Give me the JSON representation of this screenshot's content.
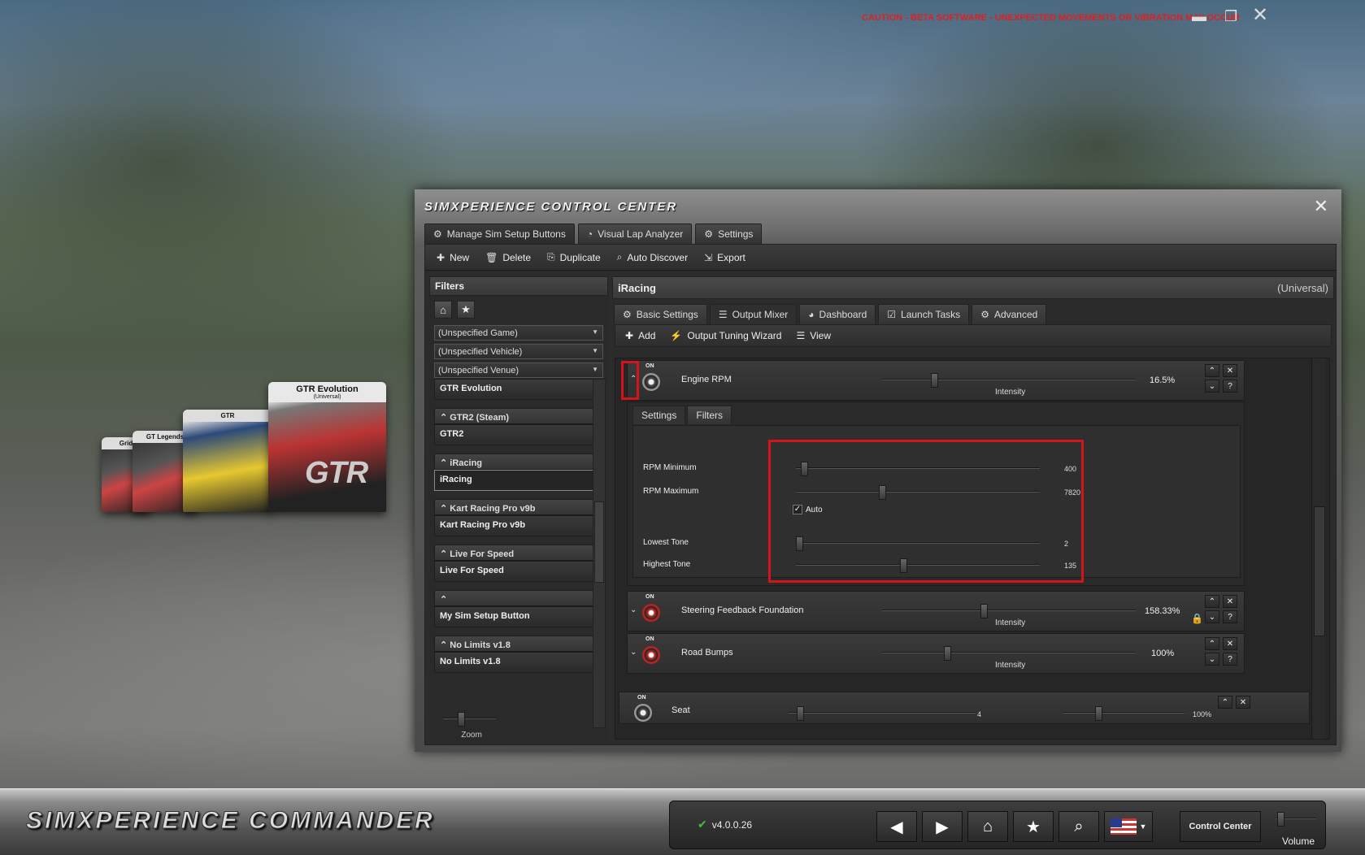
{
  "caution": "CAUTION - BETA SOFTWARE - UNEXPECTED MOVEMENTS OR VIBRATION MAY OCCUR",
  "covers": [
    "Grid",
    "GT Legends",
    "GTR",
    "GTR Evolution"
  ],
  "cover_sub": "(Universal)",
  "cover_logo": "GTR",
  "window": {
    "title": "SIMXPERIENCE CONTROL CENTER",
    "tabs": [
      "Manage Sim Setup Buttons",
      "Visual Lap Analyzer",
      "Settings"
    ]
  },
  "toolbar": [
    "New",
    "Delete",
    "Duplicate",
    "Auto Discover",
    "Export"
  ],
  "filters": {
    "title": "Filters",
    "game": "(Unspecified Game)",
    "vehicle": "(Unspecified Vehicle)",
    "venue": "(Unspecified Venue)"
  },
  "games": {
    "top": "GTR Evolution",
    "groups": [
      {
        "head": "GTR2 (Steam)",
        "item": "GTR2"
      },
      {
        "head": "iRacing",
        "item": "iRacing"
      },
      {
        "head": "Kart Racing Pro v9b",
        "item": "Kart Racing Pro v9b"
      },
      {
        "head": "Live For Speed",
        "item": "Live For Speed"
      },
      {
        "head": "",
        "item": "My Sim Setup Button"
      },
      {
        "head": "No Limits v1.8",
        "item": "No Limits v1.8"
      }
    ]
  },
  "zoom_label": "Zoom",
  "content": {
    "title": "iRacing",
    "scope": "(Universal)",
    "tabs": [
      "Basic Settings",
      "Output Mixer",
      "Dashboard",
      "Launch Tasks",
      "Advanced"
    ],
    "subtools": [
      "Add",
      "Output Tuning Wizard",
      "View"
    ]
  },
  "mixer": {
    "on_label": "ON",
    "intensity_label": "Intensity",
    "rows": [
      {
        "name": "Engine RPM",
        "pct": "16.5%",
        "level": 0.2
      },
      {
        "name": "Steering Feedback Foundation",
        "pct": "158.33%",
        "level": 0.4
      },
      {
        "name": "Road Bumps",
        "pct": "100%",
        "level": 0.25
      }
    ],
    "seat": {
      "name": "Seat",
      "val1": "4",
      "val2": "100%"
    },
    "inner_tabs": [
      "Settings",
      "Filters"
    ],
    "params": [
      {
        "label": "RPM Minimum",
        "value": "400",
        "level": 0.02
      },
      {
        "label": "RPM Maximum",
        "value": "7820",
        "level": 0.35
      },
      {
        "label": "Lowest Tone",
        "value": "2",
        "level": 0.0
      },
      {
        "label": "Highest Tone",
        "value": "135",
        "level": 0.44
      }
    ],
    "auto_label": "Auto",
    "auto_checked": true
  },
  "bottom": {
    "brand": "SIMXPERIENCE COMMANDER",
    "version": "v4.0.0.26",
    "control_center": "Control Center",
    "volume": "Volume"
  },
  "colors": {
    "caution": "#e02020",
    "highlight": "#d4141c",
    "check": "#3fbf3f"
  }
}
